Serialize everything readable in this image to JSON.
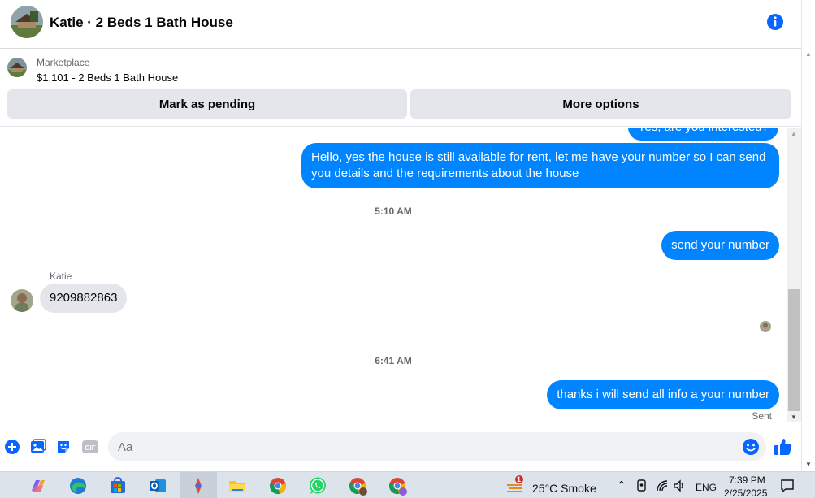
{
  "header": {
    "title": "Katie · 2 Beds 1 Bath House",
    "info_icon": "info-icon"
  },
  "marketplace": {
    "label": "Marketplace",
    "listing": "$1,101 - 2 Beds 1 Bath House",
    "mark_pending_label": "Mark as pending",
    "more_options_label": "More options"
  },
  "conversation": {
    "partial_message": "Yes, are you interested?",
    "messages": [
      {
        "from": "me",
        "text": "Hello, yes the house is still available for rent, let me have your number so I can send you details and the requirements about the house"
      },
      {
        "type": "time",
        "text": "5:10 AM"
      },
      {
        "from": "me",
        "text": "send your number"
      },
      {
        "from": "Katie",
        "sender_name": "Katie",
        "text": "9209882863"
      },
      {
        "type": "time",
        "text": "6:41 AM"
      },
      {
        "from": "me",
        "text": "thanks i will send all info a your number"
      }
    ],
    "status": "Sent"
  },
  "composer": {
    "placeholder": "Aa",
    "icons": [
      "plus-circle-icon",
      "photo-icon",
      "sticker-icon",
      "gif-icon",
      "emoji-icon",
      "thumbs-up-icon"
    ],
    "gif_label": "GIF"
  },
  "taskbar": {
    "apps": [
      "copilot-icon",
      "edge-icon",
      "store-icon",
      "outlook-icon",
      "paint-icon",
      "file-explorer-icon",
      "chrome-icon",
      "whatsapp-icon",
      "chrome-profile-c-icon",
      "chrome-profile-icon"
    ],
    "weather": {
      "temp": "25°C",
      "condition": "Smoke",
      "badge": "1"
    },
    "language": "ENG",
    "time": "7:39 PM",
    "date": "2/25/2025"
  },
  "colors": {
    "messenger_blue": "#0084ff",
    "bubble_gray": "#e4e6eb",
    "secondary_text": "#65676b"
  }
}
